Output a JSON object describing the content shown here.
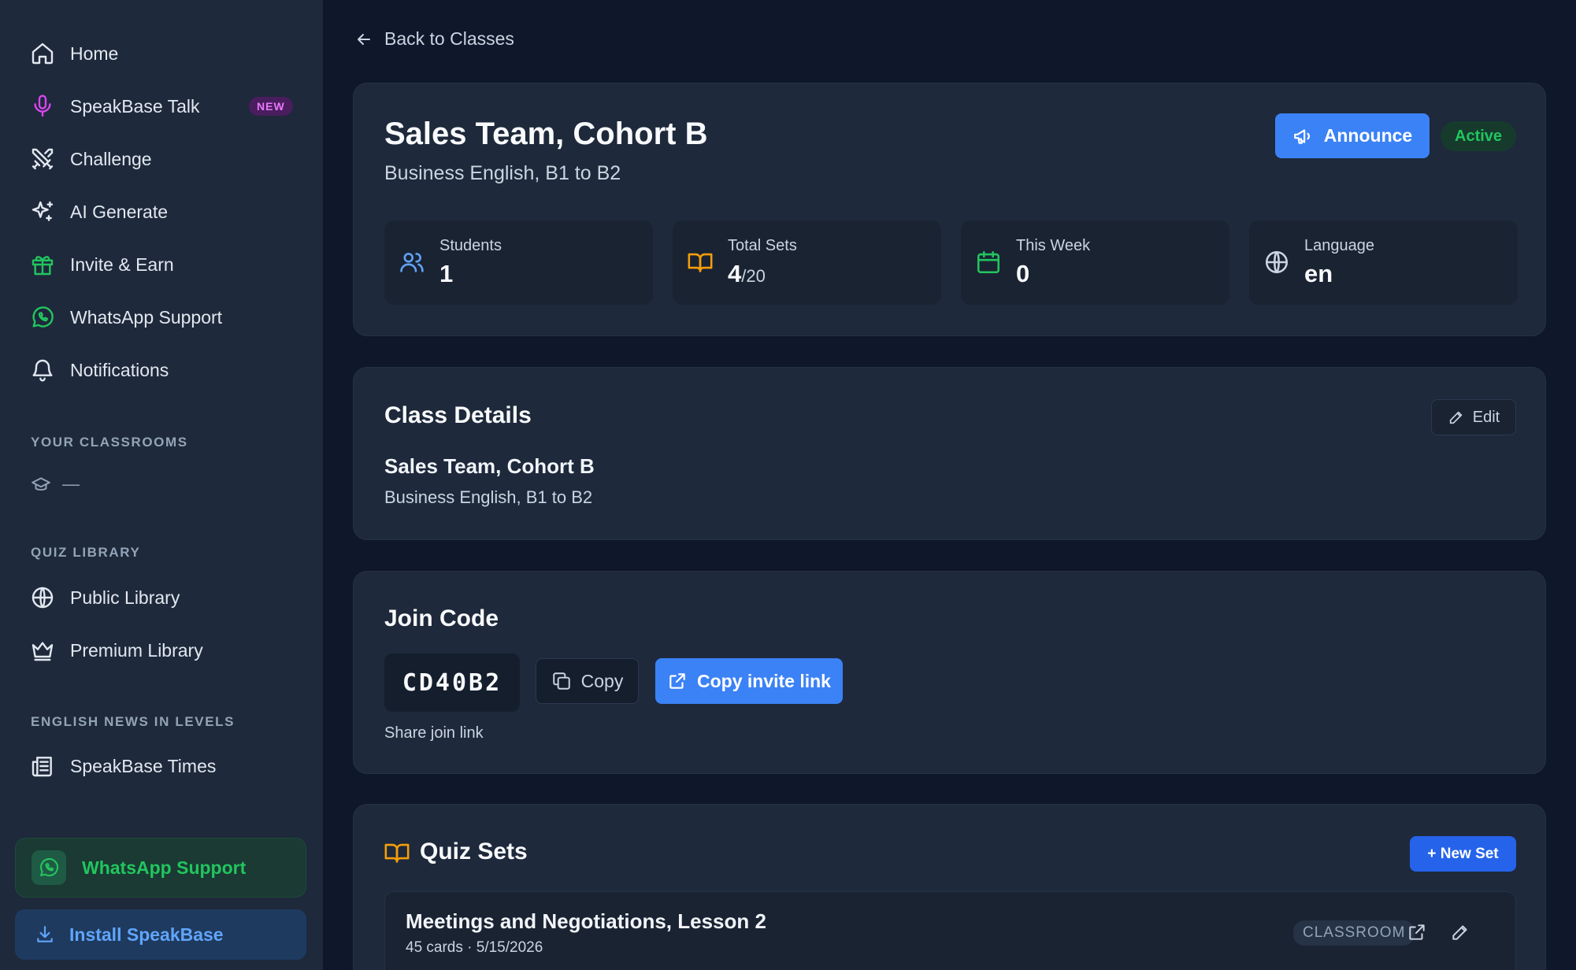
{
  "sidebar": {
    "items": [
      {
        "label": "Home",
        "icon": "home-icon"
      },
      {
        "label": "SpeakBase Talk",
        "icon": "microphone-icon",
        "badge": "NEW"
      },
      {
        "label": "Challenge",
        "icon": "swords-icon"
      },
      {
        "label": "AI Generate",
        "icon": "sparkles-icon"
      },
      {
        "label": "Invite & Earn",
        "icon": "gift-icon"
      },
      {
        "label": "WhatsApp Support",
        "icon": "whatsapp-icon"
      },
      {
        "label": "Notifications",
        "icon": "bell-icon"
      }
    ],
    "classrooms_title": "YOUR CLASSROOMS",
    "classrooms_empty": "—",
    "library_title": "QUIZ LIBRARY",
    "library_items": [
      {
        "label": "Public Library",
        "icon": "globe-icon"
      },
      {
        "label": "Premium Library",
        "icon": "crown-icon"
      }
    ],
    "news_title": "ENGLISH NEWS IN LEVELS",
    "news_items": [
      {
        "label": "SpeakBase Times",
        "icon": "newspaper-icon"
      }
    ],
    "whatsapp_cta": "WhatsApp Support",
    "install_cta": "Install SpeakBase"
  },
  "back_link": "Back to Classes",
  "class": {
    "title": "Sales Team, Cohort B",
    "subtitle": "Business English, B1 to B2",
    "announce_label": "Announce",
    "status": "Active",
    "stats": [
      {
        "label": "Students",
        "value": "1",
        "icon": "users-icon"
      },
      {
        "label": "Total Sets",
        "value": "4",
        "sub": "/20",
        "icon": "book-open-icon"
      },
      {
        "label": "This Week",
        "value": "0",
        "icon": "calendar-icon"
      },
      {
        "label": "Language",
        "value": "en",
        "icon": "globe-icon"
      }
    ]
  },
  "details": {
    "heading": "Class Details",
    "edit_label": "Edit",
    "name": "Sales Team, Cohort B",
    "description": "Business English, B1 to B2"
  },
  "join": {
    "heading": "Join Code",
    "code": "CD40B2",
    "copy_label": "Copy",
    "invite_label": "Copy invite link",
    "share_label": "Share join link"
  },
  "quiz_sets": {
    "heading": "Quiz Sets",
    "new_label": "+ New Set",
    "items": [
      {
        "title": "Meetings and Negotiations, Lesson 2",
        "meta": "45 cards · 5/15/2026",
        "badge": "CLASSROOM"
      }
    ]
  },
  "colors": {
    "background": "#0f172a",
    "sidebar": "#1e293b",
    "card": "#1e293b",
    "accent": "#3b82f6",
    "success": "#22c55e",
    "new_badge": "#e879f9"
  }
}
